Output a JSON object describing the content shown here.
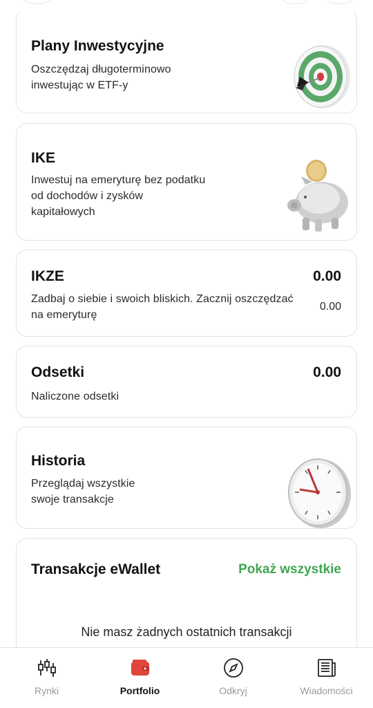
{
  "cards": {
    "plans": {
      "title": "Plany Inwestycyjne",
      "desc_line1": "Oszczędzaj długoterminowo",
      "desc_line2": "inwestując w ETF-y",
      "icon": "target-icon"
    },
    "ike": {
      "title": "IKE",
      "desc_line1": "Inwestuj na emeryturę bez podatku",
      "desc_line2": "od dochodów i zysków",
      "desc_line3": "kapitałowych",
      "icon": "piggy-bank-icon"
    },
    "ikze": {
      "title": "IKZE",
      "value": "0.00",
      "desc_line1": "Zadbaj o siebie i swoich bliskich. Zacznij oszczędzać",
      "desc_line2": "na emeryturę",
      "subvalue": "0.00"
    },
    "interest": {
      "title": "Odsetki",
      "value": "0.00",
      "desc": "Naliczone odsetki"
    },
    "history": {
      "title": "Historia",
      "desc_line1": "Przeglądaj wszystkie",
      "desc_line2": "swoje transakcje",
      "icon": "clock-icon"
    },
    "ewallet": {
      "title": "Transakcje eWallet",
      "link": "Pokaż wszystkie",
      "empty": "Nie masz żadnych ostatnich transakcji"
    }
  },
  "tabbar": {
    "items": [
      {
        "label": "Rynki",
        "icon": "candlestick-icon",
        "active": false
      },
      {
        "label": "Portfolio",
        "icon": "wallet-icon",
        "active": true
      },
      {
        "label": "Odkryj",
        "icon": "compass-icon",
        "active": false
      },
      {
        "label": "Wiadomości",
        "icon": "newspaper-icon",
        "active": false
      }
    ]
  },
  "colors": {
    "accent_green": "#3fa550",
    "active_red": "#e0463c",
    "muted": "#9a9a9a"
  }
}
